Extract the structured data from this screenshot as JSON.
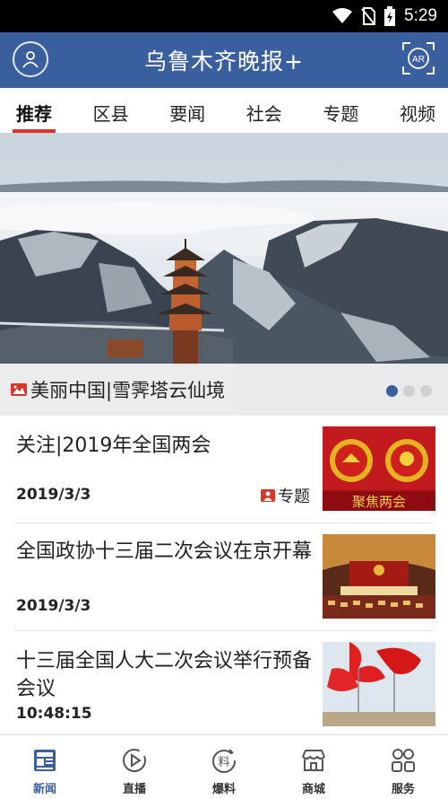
{
  "status_bar": {
    "time": "5:29"
  },
  "header": {
    "title": "乌鲁木齐晚报+",
    "ar_label": "AR"
  },
  "tabs": [
    {
      "label": "推荐",
      "active": true
    },
    {
      "label": "区县"
    },
    {
      "label": "要闻"
    },
    {
      "label": "社会"
    },
    {
      "label": "专题"
    },
    {
      "label": "视频"
    }
  ],
  "hero": {
    "caption": "美丽中国|雪霁塔云仙境",
    "slides": 3,
    "current_slide": 1
  },
  "news": [
    {
      "title": "关注|2019年全国两会",
      "date": "2019/3/3",
      "tag": "专题"
    },
    {
      "title": "全国政协十三届二次会议在京开幕",
      "date": "2019/3/3"
    },
    {
      "title": "十三届全国人大二次会议举行预备会议",
      "date": "10:48:15"
    }
  ],
  "thumb_text": "聚焦两会",
  "bottom_nav": [
    {
      "label": "新闻",
      "icon": "news-icon",
      "active": true
    },
    {
      "label": "直播",
      "icon": "play-icon"
    },
    {
      "label": "爆料",
      "icon": "tip-off-icon"
    },
    {
      "label": "商城",
      "icon": "store-icon"
    },
    {
      "label": "服务",
      "icon": "services-icon"
    }
  ],
  "colors": {
    "brand": "#3a5f9f",
    "accent_red": "#d9362b"
  }
}
